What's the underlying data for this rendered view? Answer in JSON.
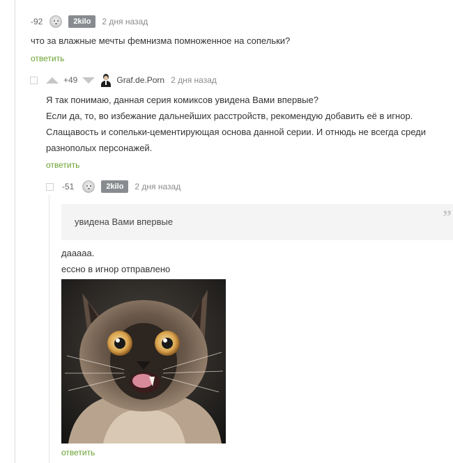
{
  "comments": [
    {
      "rating": "-92",
      "username": "2kilo",
      "time": "2 дня назад",
      "text": "что за влажные мечты фемнизма помноженное на сопельки?",
      "reply_label": "ответить"
    },
    {
      "rating": "+49",
      "username": "Graf.de.Porn",
      "time": "2 дня назад",
      "lines": [
        "Я так понимаю, данная серия комиксов увидена Вами впервые?",
        "Если да, то, во избежание дальнейших расстройств, рекомендую добавить её в игнор.",
        "Слащавость и сопельки-цементирующая основа данной серии. И отнюдь не всегда среди",
        "разнополых персонажей."
      ],
      "reply_label": "ответить"
    },
    {
      "rating": "-51",
      "username": "2kilo",
      "time": "2 дня назад",
      "quote": "увидена Вами впервые",
      "quote_mark": "”",
      "lines": [
        "дааааа.",
        "ессно в игнор отправлено"
      ],
      "image": "cat-photo",
      "reply_label": "ответить"
    }
  ]
}
